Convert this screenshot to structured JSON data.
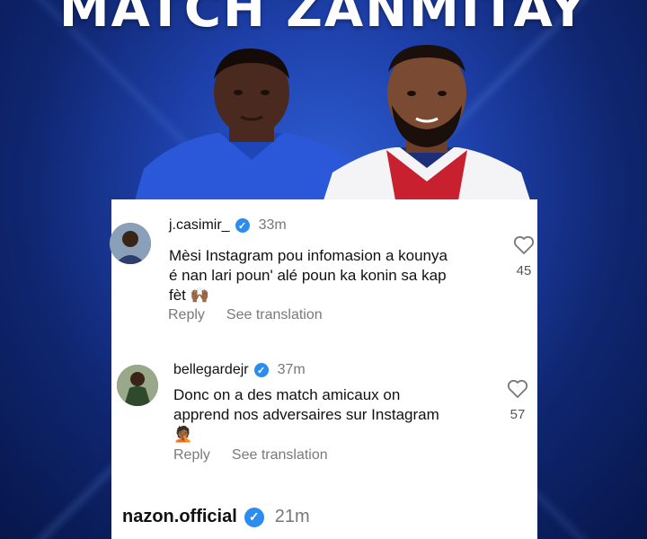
{
  "banner": {
    "headline": "MATCH ZANMITAY"
  },
  "comments": [
    {
      "username": "j.casimir_",
      "time": "33m",
      "text_line1": "Mèsi Instagram pou infomasion a kounya",
      "text_line2": "é nan lari poun' alé poun ka konin sa kap",
      "text_line3": "fèt 🙌🏾",
      "reply": "Reply",
      "translate": "See translation",
      "likes": "45"
    },
    {
      "username": "bellegardejr",
      "time": "37m",
      "text_line1": "Donc on a des match amicaux on",
      "text_line2": "apprend nos adversaires sur Instagram",
      "text_line3": "🤦🏾",
      "reply": "Reply",
      "translate": "See translation",
      "likes": "57"
    },
    {
      "username": "nazon.official",
      "time": "21m"
    }
  ],
  "colors": {
    "background": "#1d3fa8",
    "verified": "#2d8cf0",
    "card": "#ffffff"
  },
  "icons": [
    "verified-badge-icon",
    "heart-icon"
  ]
}
